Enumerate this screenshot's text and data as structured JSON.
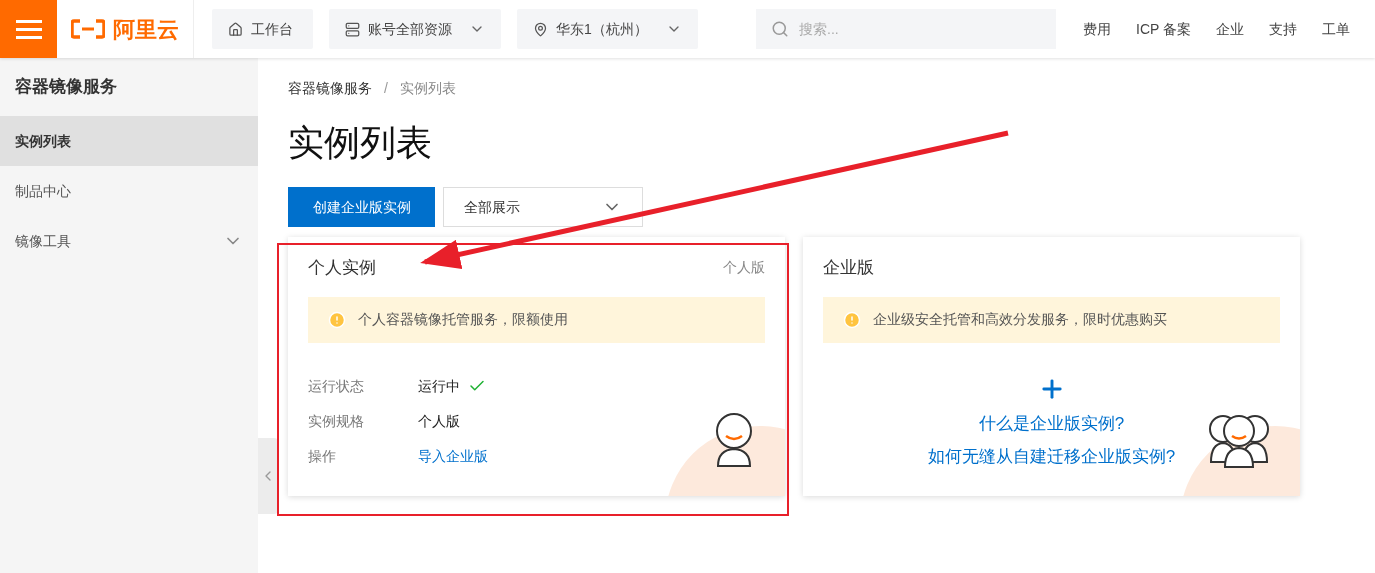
{
  "header": {
    "brand": "阿里云",
    "nav_buttons": [
      {
        "kind": "home",
        "label": "工作台"
      },
      {
        "kind": "resources",
        "label": "账号全部资源"
      },
      {
        "kind": "region",
        "label": "华东1（杭州）"
      }
    ],
    "search": {
      "placeholder": "搜索..."
    },
    "links": [
      "费用",
      "ICP 备案",
      "企业",
      "支持",
      "工单"
    ]
  },
  "sidebar": {
    "title": "容器镜像服务",
    "items": [
      {
        "label": "实例列表",
        "kind": "link",
        "selected": true
      },
      {
        "label": "制品中心",
        "kind": "link",
        "selected": false
      },
      {
        "label": "镜像工具",
        "kind": "group",
        "selected": false
      }
    ]
  },
  "breadcrumb": {
    "items": [
      "容器镜像服务",
      "实例列表"
    ],
    "separator": "/"
  },
  "page_title": "实例列表",
  "create_button": "创建企业版实例",
  "filter": {
    "value": "全部展示"
  },
  "cards": [
    {
      "kind": "personal",
      "title": "个人实例",
      "tag": "个人版",
      "notice": "个人容器镜像托管服务，限额使用",
      "fields": [
        {
          "label": "运行状态",
          "value": "运行中",
          "kind": "status"
        },
        {
          "label": "实例规格",
          "value": "个人版",
          "kind": "text"
        },
        {
          "label": "操作",
          "value": "导入企业版",
          "kind": "link"
        }
      ]
    },
    {
      "kind": "enterprise",
      "title": "企业版",
      "notice": "企业级安全托管和高效分发服务，限时优惠购买",
      "links": [
        "什么是企业版实例?",
        "如何无缝从自建迁移企业版实例?"
      ]
    }
  ],
  "annotations": {
    "highlight": true,
    "arrow": true
  }
}
